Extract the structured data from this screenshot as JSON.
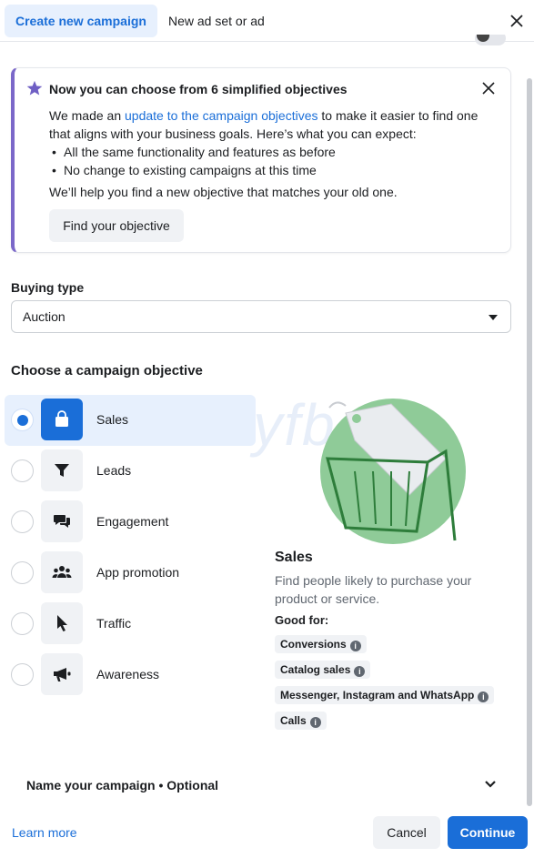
{
  "tabs": [
    {
      "label": "Create new campaign",
      "active": true
    },
    {
      "label": "New ad set or ad",
      "active": false
    }
  ],
  "colors": {
    "accent": "#1a6ed8",
    "card_border_accent": "#7b68c9",
    "illustration_green": "#8fcb98"
  },
  "notice": {
    "title": "Now you can choose from 6 simplified objectives",
    "body_pre": "We made an ",
    "body_link": "update to the campaign objectives",
    "body_post": " to make it easier to find one that aligns with your business goals. Here’s what you can expect:",
    "bullets": [
      "All the same functionality and features as before",
      "No change to existing campaigns at this time"
    ],
    "help_text": "We’ll help you find a new objective that matches your old one.",
    "button_label": "Find your objective"
  },
  "buying_type": {
    "label": "Buying type",
    "value": "Auction"
  },
  "objectives": {
    "heading": "Choose a campaign objective",
    "items": [
      {
        "label": "Sales",
        "icon": "shopping-bag-icon",
        "selected": true
      },
      {
        "label": "Leads",
        "icon": "filter-icon",
        "selected": false
      },
      {
        "label": "Engagement",
        "icon": "chat-bubbles-icon",
        "selected": false
      },
      {
        "label": "App promotion",
        "icon": "people-icon",
        "selected": false
      },
      {
        "label": "Traffic",
        "icon": "cursor-icon",
        "selected": false
      },
      {
        "label": "Awareness",
        "icon": "megaphone-icon",
        "selected": false
      }
    ]
  },
  "watermark": "Veryfb",
  "detail": {
    "title": "Sales",
    "description": "Find people likely to purchase your product or service.",
    "good_for_label": "Good for:",
    "chips": [
      "Conversions",
      "Catalog sales",
      "Messenger, Instagram and WhatsApp",
      "Calls"
    ]
  },
  "name_campaign": {
    "label": "Name your campaign • Optional"
  },
  "footer": {
    "learn_more": "Learn more",
    "cancel": "Cancel",
    "continue": "Continue"
  }
}
